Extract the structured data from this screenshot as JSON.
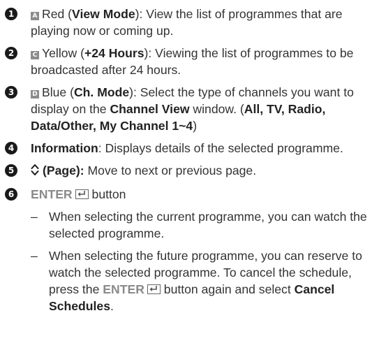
{
  "items": [
    {
      "num": "1",
      "key_letter": "A",
      "color_word": "Red",
      "open": " (",
      "bold": "View Mode",
      "close": ")",
      "desc": ": View the list of programmes that are playing now or coming up."
    },
    {
      "num": "2",
      "key_letter": "C",
      "color_word": "Yellow",
      "open": " (",
      "bold": "+24 Hours",
      "close": ")",
      "desc": ": Viewing the list of programmes to be broadcasted after 24 hours."
    },
    {
      "num": "3",
      "key_letter": "D",
      "color_word": "Blue",
      "open": " (",
      "bold": "Ch. Mode",
      "close": ")",
      "desc": ": Select the type of channels you want to display on the ",
      "bold2": "Channel View",
      "desc2": " window. (",
      "bold3": "All, TV, Radio, Data/Other, My Channel 1~4",
      "desc3": ")"
    },
    {
      "num": "4",
      "bold": "Information",
      "desc": ": Displays details of the selected programme."
    },
    {
      "num": "5",
      "icon": "page-up-down-icon",
      "bold": "(Page):",
      "desc": " Move to next or previous page."
    },
    {
      "num": "6",
      "gray": "ENTER",
      "icon": "enter-icon",
      "desc": " button",
      "subs": [
        {
          "dash": "–",
          "text": "When selecting the current programme, you can watch the selected programme."
        },
        {
          "dash": "–",
          "text": "When selecting the future programme, you can reserve to watch the selected programme. To cancel the schedule, press the ",
          "gray": "ENTER",
          "text2": " button again and select ",
          "bold": "Cancel Schedules",
          "text3": "."
        }
      ]
    }
  ],
  "colors": {
    "text": "#333333",
    "number_circle": "#1a1a1a",
    "key_box": "#8c8c8c",
    "enter_text": "#8a8a8a"
  }
}
